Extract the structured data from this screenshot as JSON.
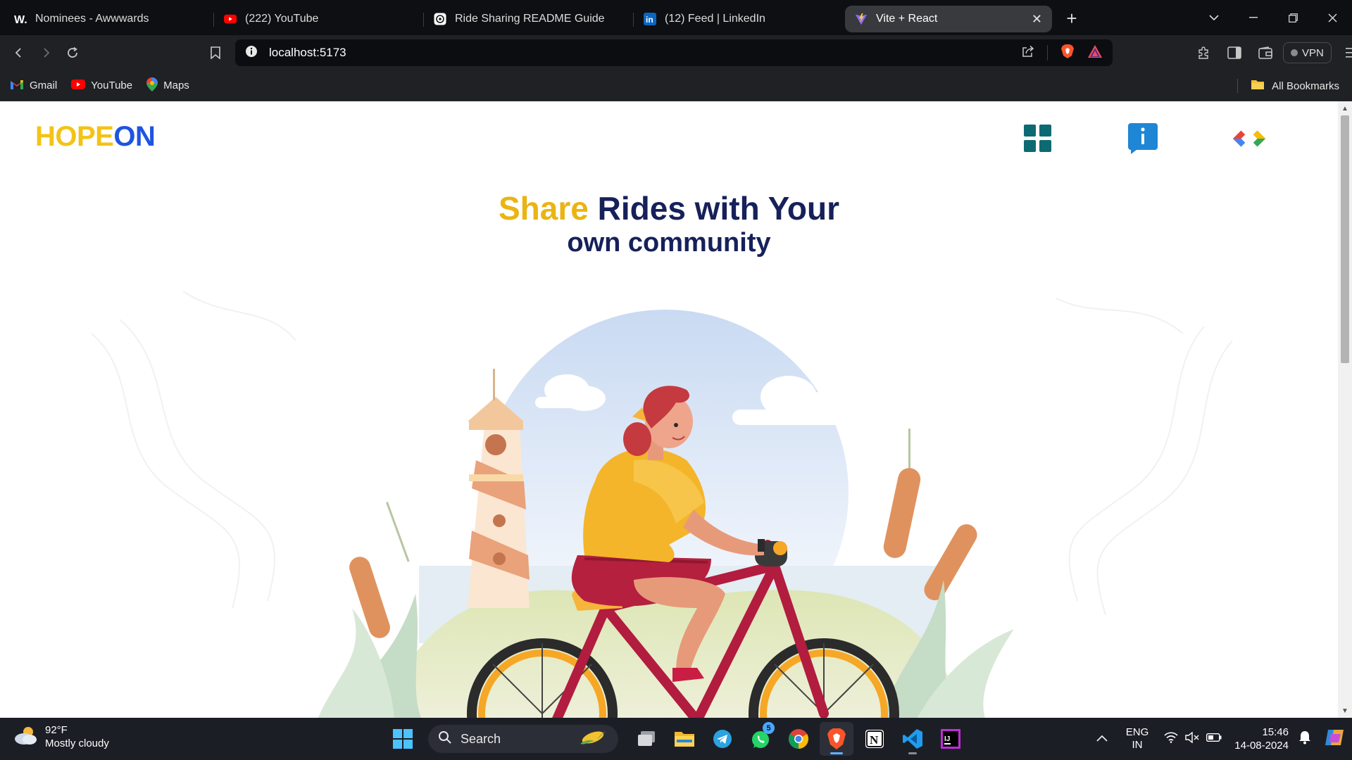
{
  "browser": {
    "tabs": [
      {
        "title": "Nominees - Awwwards",
        "icon": "awwwards-icon",
        "active": false
      },
      {
        "title": "(222) YouTube",
        "icon": "youtube-icon",
        "active": false
      },
      {
        "title": "Ride Sharing README Guide",
        "icon": "chatgpt-icon",
        "active": false
      },
      {
        "title": "(12) Feed | LinkedIn",
        "icon": "linkedin-icon",
        "active": false
      },
      {
        "title": "Vite + React",
        "icon": "vite-icon",
        "active": true
      }
    ],
    "tab_close_glyph": "✕",
    "new_tab_glyph": "+",
    "window_controls": {
      "tab_search": "⌄",
      "minimize": "—",
      "maximize": "❐",
      "close": "✕"
    },
    "address_bar": {
      "url": "localhost:5173"
    },
    "vpn_label": "VPN",
    "bookmarks": [
      {
        "label": "Gmail",
        "icon": "gmail-icon"
      },
      {
        "label": "YouTube",
        "icon": "youtube-icon"
      },
      {
        "label": "Maps",
        "icon": "maps-icon"
      }
    ],
    "all_bookmarks_label": "All Bookmarks"
  },
  "page": {
    "logo": {
      "part1": "HOPE",
      "part2": "ON"
    },
    "nav_icons": [
      "grid-icon",
      "info-icon",
      "code-icon"
    ],
    "hero": {
      "accent_word": "Share",
      "line1_rest": " Rides with Your",
      "line2": "own community"
    },
    "illustration": "woman-riding-bicycle-illustration",
    "colors": {
      "logo_yellow": "#f3c316",
      "logo_blue": "#1e55e0",
      "heading_navy": "#16215a",
      "accent_yellow": "#eab413",
      "grid_teal": "#0d6a73",
      "info_blue": "#1f86d6"
    }
  },
  "taskbar": {
    "weather": {
      "temp": "92°F",
      "condition": "Mostly cloudy"
    },
    "search_label": "Search",
    "whatsapp_badge": "5",
    "tray": {
      "lang1": "ENG",
      "lang2": "IN",
      "time": "15:46",
      "date": "14-08-2024"
    }
  }
}
